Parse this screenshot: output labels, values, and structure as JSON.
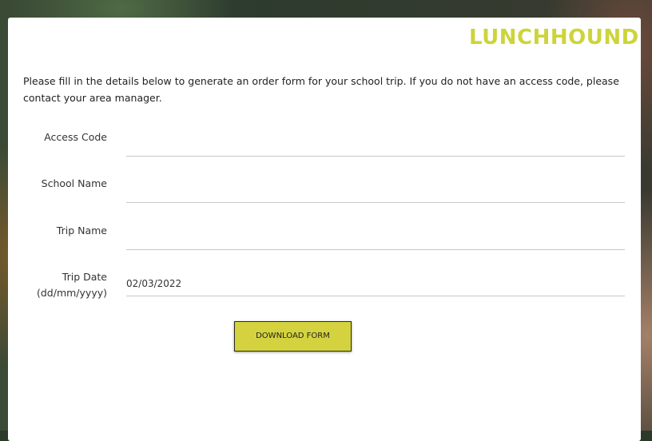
{
  "brand": {
    "logo_text": "LUNCHHOUND",
    "accent_color": "#cdd43a"
  },
  "intro": "Please fill in the details below to generate an order form for your school trip. If you do not have an access code, please contact your area manager.",
  "form": {
    "access_code": {
      "label": "Access Code",
      "value": ""
    },
    "school_name": {
      "label": "School Name",
      "value": ""
    },
    "trip_name": {
      "label": "Trip Name",
      "value": ""
    },
    "trip_date": {
      "label_line1": "Trip Date",
      "label_line2": "(dd/mm/yyyy)",
      "value": "02/03/2022"
    }
  },
  "download_button": {
    "label": "DOWNLOAD FORM",
    "color": "#d4d33f"
  }
}
